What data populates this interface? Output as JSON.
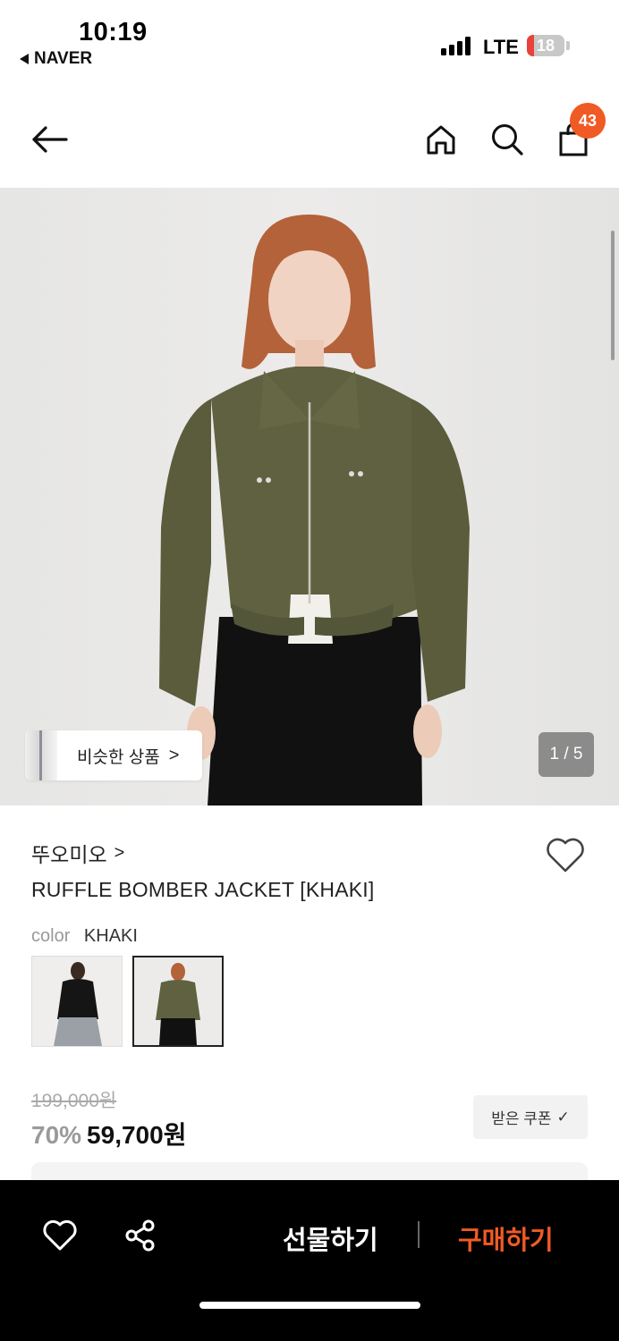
{
  "status_bar": {
    "time": "10:19",
    "back_app": "NAVER",
    "network": "LTE",
    "battery": "18",
    "battery_level": 0.18
  },
  "nav": {
    "cart_count": "43",
    "icons": [
      "back-arrow-icon",
      "home-icon",
      "search-icon",
      "shopping-bag-icon"
    ]
  },
  "hero": {
    "similar_label": "비슷한 상품",
    "similar_chevron": ">",
    "pager": "1 / 5"
  },
  "product": {
    "brand": "뚜오미오",
    "brand_chevron": ">",
    "title": "RUFFLE BOMBER JACKET [KHAKI]",
    "color_key": "color",
    "color_value": "KHAKI",
    "original_price": "199,000원",
    "discount": "70%",
    "price": "59,700원",
    "coupon_label": "받은 쿠폰",
    "coupon_check": "✓"
  },
  "actions": {
    "gift": "선물하기",
    "buy": "구매하기"
  },
  "colors": {
    "accent": "#f05a24",
    "khaki": "#5f6140",
    "bar": "#000000"
  }
}
